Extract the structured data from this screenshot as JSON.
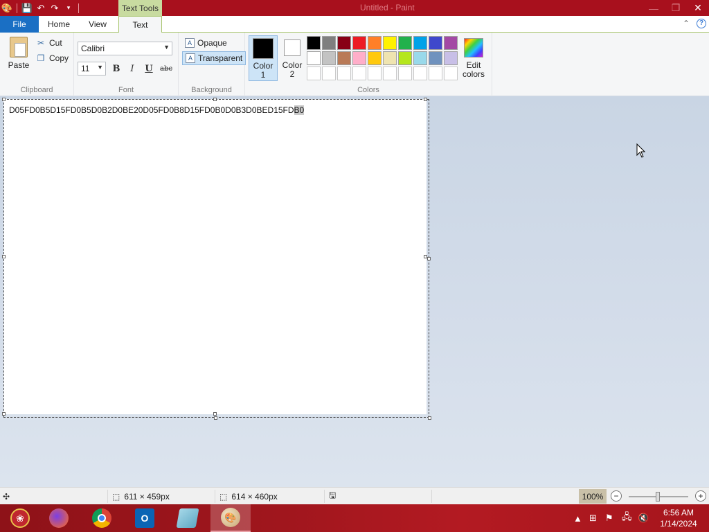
{
  "window": {
    "title": "Untitled - Paint",
    "context_tab": "Text Tools"
  },
  "tabs": {
    "file": "File",
    "home": "Home",
    "view": "View",
    "text": "Text"
  },
  "clipboard": {
    "paste": "Paste",
    "cut": "Cut",
    "copy": "Copy",
    "label": "Clipboard"
  },
  "font": {
    "family": "Calibri",
    "size": "11",
    "bold": "B",
    "italic": "I",
    "underline": "U",
    "strike": "abc",
    "label": "Font"
  },
  "background": {
    "opaque": "Opaque",
    "transparent": "Transparent",
    "label": "Background"
  },
  "colors": {
    "color1_line1": "Color",
    "color1_line2": "1",
    "color2_line1": "Color",
    "color2_line2": "2",
    "edit_line1": "Edit",
    "edit_line2": "colors",
    "label": "Colors",
    "color1_value": "#000000",
    "color2_value": "#ffffff",
    "palette": [
      "#000000",
      "#7f7f7f",
      "#880015",
      "#ed1c24",
      "#ff7f27",
      "#fff200",
      "#22b14c",
      "#00a2e8",
      "#3f48cc",
      "#a349a4",
      "#ffffff",
      "#c3c3c3",
      "#b97a57",
      "#ffaec9",
      "#ffc90e",
      "#efe4b0",
      "#b5e61d",
      "#99d9ea",
      "#7092be",
      "#c8bfe7",
      "#ffffff",
      "#ffffff",
      "#ffffff",
      "#ffffff",
      "#ffffff",
      "#ffffff",
      "#ffffff",
      "#ffffff",
      "#ffffff",
      "#ffffff"
    ]
  },
  "canvas": {
    "text_main": "D05FD0B5D15FD0B5D0B2D0BE20D05FD0B8D15FD0B0D0B3D0BED15FD",
    "text_selected": "B0"
  },
  "status": {
    "selection_size": "611 × 459px",
    "canvas_size": "614 × 460px",
    "zoom": "100%"
  },
  "clock": {
    "time": "6:56 AM",
    "date": "1/14/2024"
  }
}
